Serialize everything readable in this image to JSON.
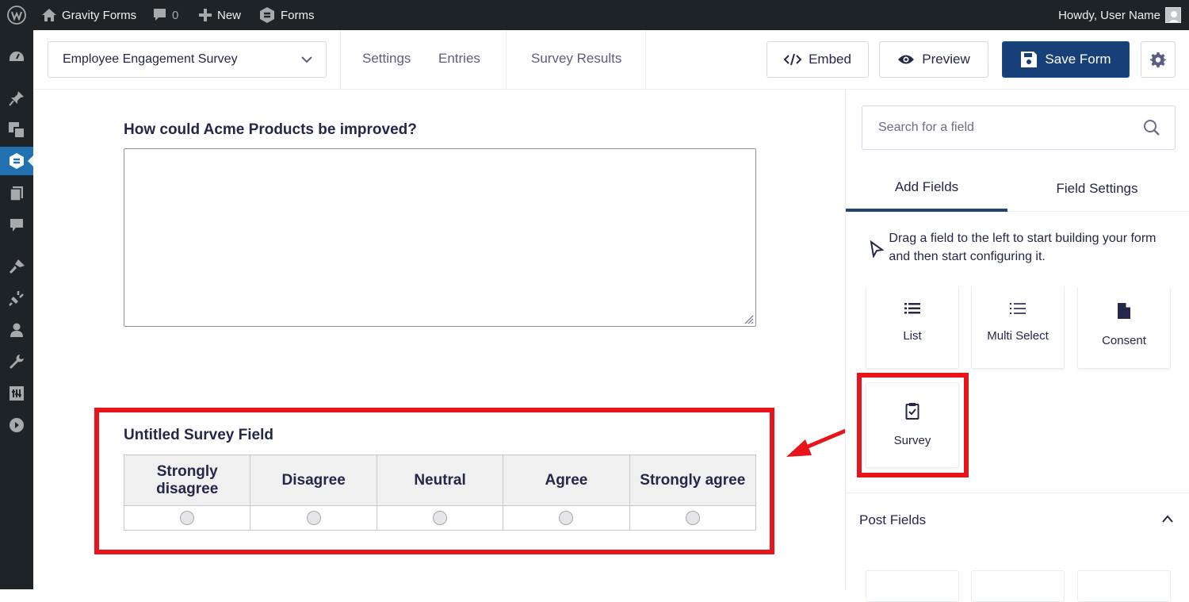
{
  "adminbar": {
    "site_name": "Gravity Forms",
    "comments_count": "0",
    "new_label": "New",
    "forms_label": "Forms",
    "howdy": "Howdy, User Name"
  },
  "toolbar": {
    "form_name": "Employee Engagement Survey",
    "links": [
      "Settings",
      "Entries",
      "Survey Results"
    ],
    "embed_label": "Embed",
    "preview_label": "Preview",
    "save_label": "Save Form"
  },
  "canvas": {
    "paragraph_label": "How could Acme Products be improved?",
    "survey_label": "Untitled Survey Field",
    "likert_columns": [
      "Strongly disagree",
      "Disagree",
      "Neutral",
      "Agree",
      "Strongly agree"
    ]
  },
  "sidebar": {
    "search_placeholder": "Search for a field",
    "tabs": [
      "Add Fields",
      "Field Settings"
    ],
    "hint": "Drag a field to the left to start building your form and then start configuring it.",
    "field_buttons": [
      "List",
      "Multi Select",
      "Consent",
      "Survey"
    ],
    "post_fields_label": "Post Fields"
  },
  "colors": {
    "highlight": "#e8141b",
    "primary": "#174079",
    "admin_dark": "#1d2327"
  }
}
